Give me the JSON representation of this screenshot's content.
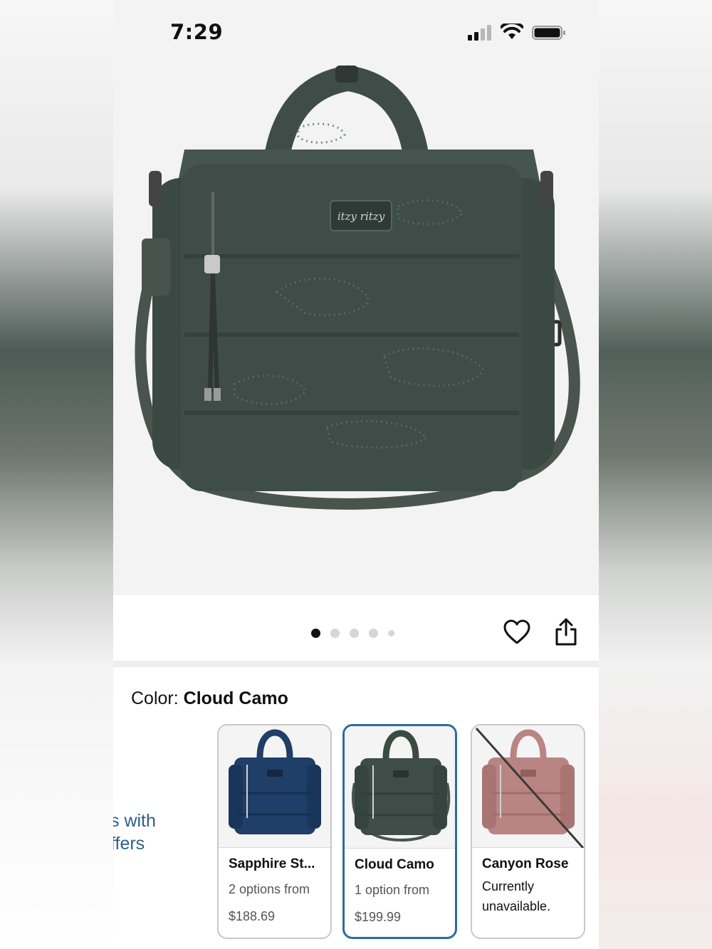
{
  "status_bar": {
    "time": "7:29",
    "icons": [
      "cellular-signal-icon",
      "wifi-icon",
      "battery-icon"
    ]
  },
  "product_image": {
    "logo_text": "itzy ritzy",
    "carousel": {
      "count": 5,
      "active_index": 0
    }
  },
  "actions": {
    "icons": [
      "heart-icon",
      "share-icon"
    ]
  },
  "color": {
    "label": "Color:",
    "selected": "Cloud Camo",
    "partial_text_line1": "s with",
    "partial_text_line2": "ffers",
    "options": [
      {
        "name": "Sapphire St...",
        "sub": "2 options from",
        "price": "$188.69",
        "color": "#1f3e68",
        "available": true,
        "selected": false
      },
      {
        "name": "Cloud Camo",
        "sub": "1 option from",
        "price": "$199.99",
        "color": "#3a4b44",
        "available": true,
        "selected": true
      },
      {
        "name": "Canyon Rose",
        "sub": "Currently unavailable.",
        "price": "",
        "color": "#b98582",
        "available": false,
        "selected": false
      }
    ]
  },
  "colors": {
    "accent": "#2e6aa1",
    "link": "#2c5f8a",
    "bag": "#3e4d47"
  }
}
